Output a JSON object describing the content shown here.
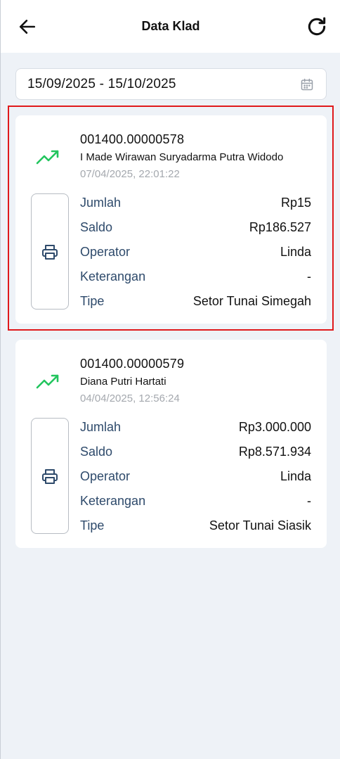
{
  "header": {
    "title": "Data Klad",
    "back_icon": "arrow-left-icon",
    "refresh_icon": "refresh-icon"
  },
  "filter": {
    "date_range": "15/09/2025 - 15/10/2025",
    "calendar_icon": "calendar-icon"
  },
  "labels": {
    "jumlah": "Jumlah",
    "saldo": "Saldo",
    "operator": "Operator",
    "keterangan": "Keterangan",
    "tipe": "Tipe"
  },
  "colors": {
    "trend": "#22c55e",
    "label": "#2e4a6b",
    "highlight": "#e0191b",
    "background": "#eef2f7"
  },
  "transactions": [
    {
      "account": "001400.00000578",
      "name": "I Made Wirawan Suryadarma Putra Widodo",
      "timestamp": "07/04/2025, 22:01:22",
      "jumlah": "Rp15",
      "saldo": "Rp186.527",
      "operator": "Linda",
      "keterangan": "-",
      "tipe": "Setor Tunai Simegah",
      "highlighted": true
    },
    {
      "account": "001400.00000579",
      "name": "Diana Putri Hartati",
      "timestamp": "04/04/2025, 12:56:24",
      "jumlah": "Rp3.000.000",
      "saldo": "Rp8.571.934",
      "operator": "Linda",
      "keterangan": "-",
      "tipe": "Setor Tunai Siasik",
      "highlighted": false
    }
  ]
}
